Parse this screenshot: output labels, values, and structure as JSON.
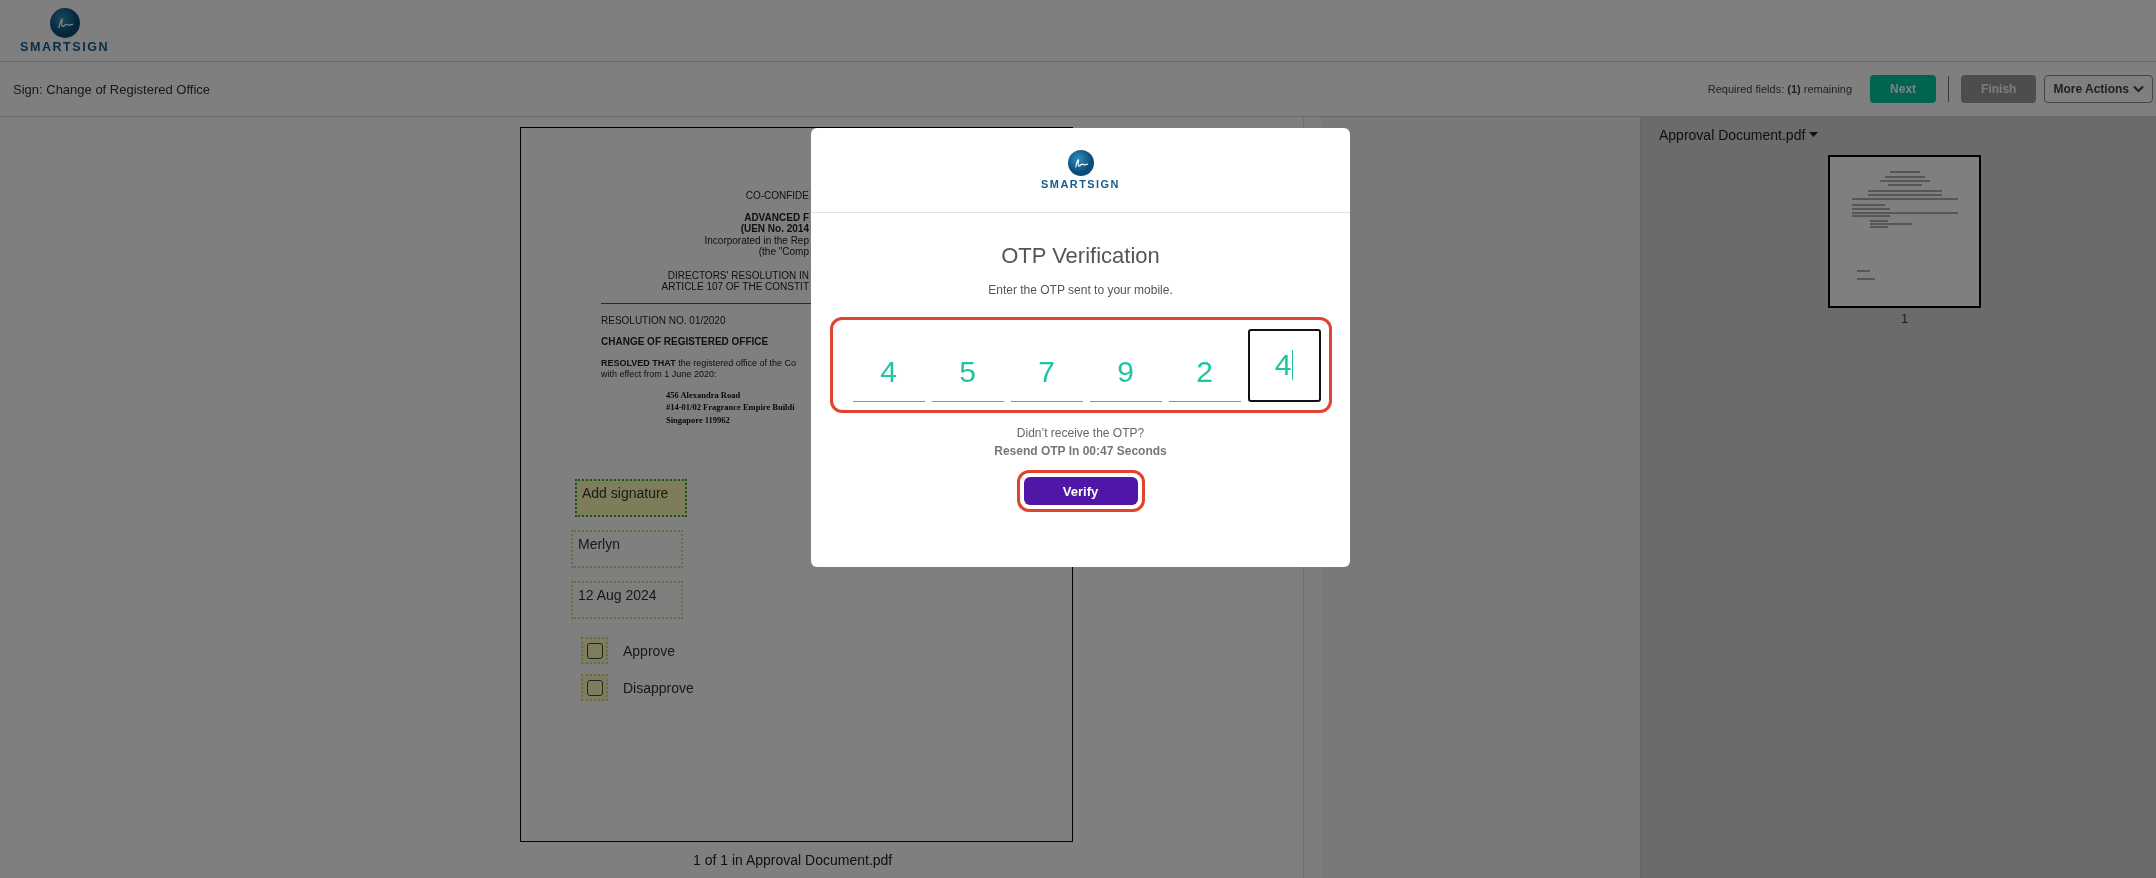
{
  "header": {
    "logo_text": "SMARTSIGN"
  },
  "title_bar": {
    "title": "Sign: Change of Registered Office",
    "required_text": "Required fields: **(1)** remaining",
    "buttons": [
      {
        "label": "Next",
        "kind": "primary",
        "disabled": false
      },
      {
        "label": "Finish",
        "kind": "primary",
        "disabled": true
      },
      {
        "label": "More Actions",
        "kind": "menu"
      }
    ]
  },
  "document": {
    "center_lines": [
      {
        "text": "CO-CONFIDE",
        "bold": false
      },
      {
        "text": "ADVANCED F",
        "bold": true
      },
      {
        "text": "(UEN No. 2014",
        "bold": true
      },
      {
        "text": "Incorporated in the Rep",
        "bold": false
      },
      {
        "text": "(the \"Comp",
        "bold": false
      }
    ],
    "heading_lines": [
      "DIRECTORS' RESOLUTION IN",
      "ARTICLE 107 OF THE CONSTIT"
    ],
    "resolution_no": "RESOLUTION NO. 01/2020",
    "subject": "CHANGE OF REGISTERED OFFICE",
    "body_lines": [
      "**RESOLVED THAT** the registered office of the Co",
      "with effect from 1 June 2020:"
    ],
    "address_lines": [
      "456 Alexandra Road",
      "#14-01/02 Fragrance Empire Buildi",
      "Singapore 119962"
    ],
    "fields": [
      {
        "kind": "signature",
        "text": "Add signature"
      },
      {
        "kind": "text",
        "text": "Merlyn"
      },
      {
        "kind": "text",
        "text": "12 Aug 2024"
      }
    ],
    "checkboxes": [
      {
        "label": "Approve",
        "checked": false
      },
      {
        "label": "Disapprove",
        "checked": false
      }
    ],
    "caption": "1 of 1 in Approval Document.pdf"
  },
  "thumbnails": {
    "file_name": "Approval Document.pdf",
    "pages": [
      {
        "label": "1",
        "selected": true
      }
    ]
  },
  "otp_dialog": {
    "logo_text": "SMARTSIGN",
    "title": "OTP Verification",
    "instruction": "Enter the OTP sent to your mobile.",
    "digits": [
      {
        "value": "4",
        "focused": false
      },
      {
        "value": "5",
        "focused": false
      },
      {
        "value": "7",
        "focused": false
      },
      {
        "value": "9",
        "focused": false
      },
      {
        "value": "2",
        "focused": false
      },
      {
        "value": "4",
        "focused": true
      }
    ],
    "digits_highlighted": true,
    "resend_question": "Didn’t receive the OTP?",
    "resend_timer": "Resend OTP In 00:47 Seconds",
    "verify_button": {
      "label": "Verify",
      "highlighted": true
    }
  }
}
